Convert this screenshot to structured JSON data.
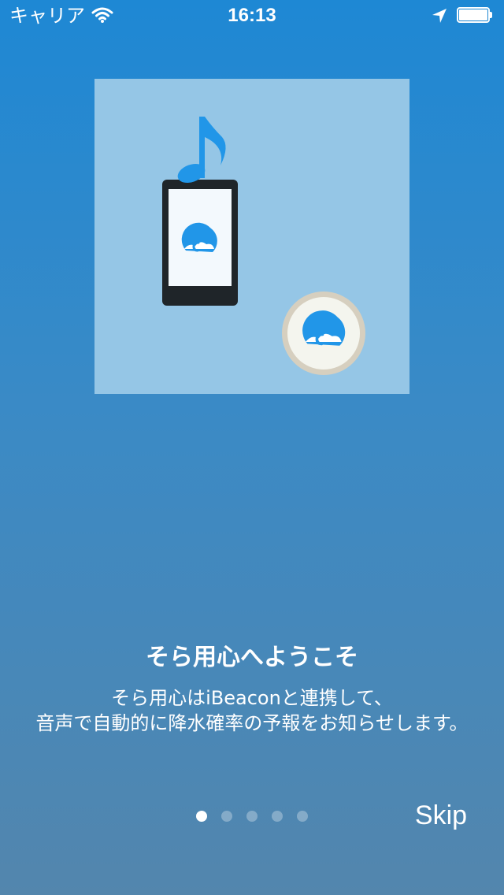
{
  "status_bar": {
    "carrier": "キャリア",
    "time": "16:13",
    "battery_level": 1.0
  },
  "illustration": {
    "icons": [
      "music-note-icon",
      "smartphone-icon",
      "umbrella-logo-icon",
      "beacon-device-icon"
    ],
    "colors": {
      "background": "#95c6e6",
      "accent_blue": "#2196e8",
      "phone_body": "#1f2529",
      "beacon_ring": "#d6cfbf"
    }
  },
  "onboarding": {
    "title": "そら用心へようこそ",
    "description_lines": [
      "そら用心はiBeaconと連携して、",
      "音声で自動的に降水確率の予報をお知らせします。"
    ]
  },
  "pager": {
    "page_count": 5,
    "current_page": 1
  },
  "skip_label": "Skip"
}
